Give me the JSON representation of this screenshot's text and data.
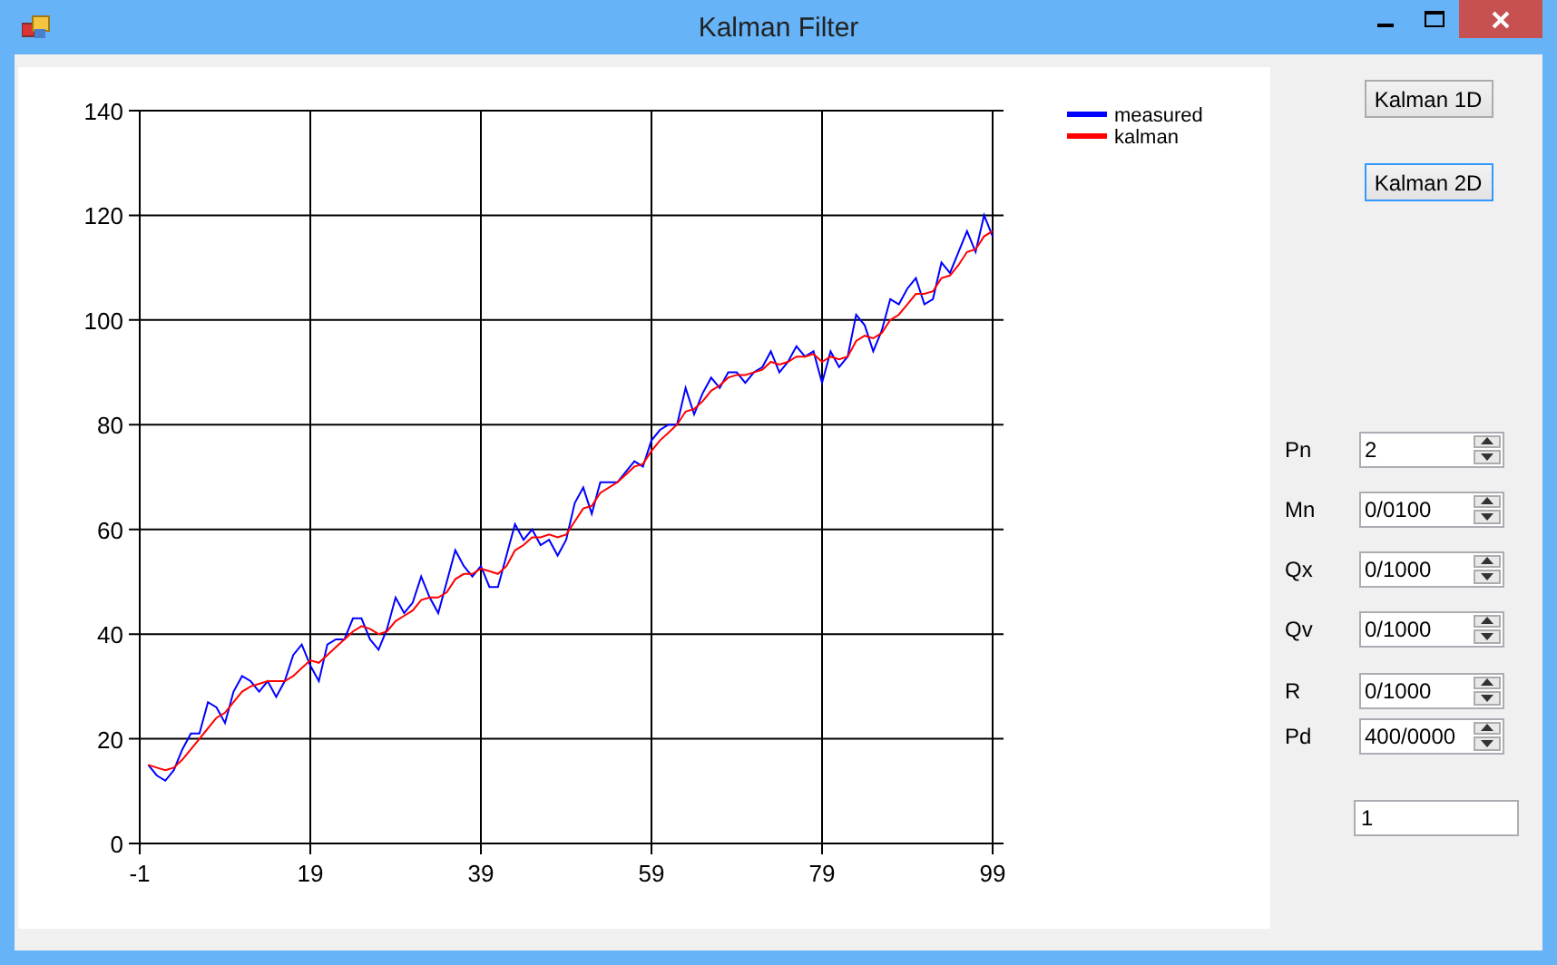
{
  "window": {
    "title": "Kalman Filter"
  },
  "chart": {
    "chart_data": {
      "type": "line",
      "grid": true,
      "legend": true,
      "xlim": [
        -1,
        99
      ],
      "ylim": [
        0,
        140
      ],
      "xticks": [
        -1,
        19,
        39,
        59,
        79,
        99
      ],
      "yticks": [
        0,
        20,
        40,
        60,
        80,
        100,
        120,
        140
      ],
      "x": [
        0,
        1,
        2,
        3,
        4,
        5,
        6,
        7,
        8,
        9,
        10,
        11,
        12,
        13,
        14,
        15,
        16,
        17,
        18,
        19,
        20,
        21,
        22,
        23,
        24,
        25,
        26,
        27,
        28,
        29,
        30,
        31,
        32,
        33,
        34,
        35,
        36,
        37,
        38,
        39,
        40,
        41,
        42,
        43,
        44,
        45,
        46,
        47,
        48,
        49,
        50,
        51,
        52,
        53,
        54,
        55,
        56,
        57,
        58,
        59,
        60,
        61,
        62,
        63,
        64,
        65,
        66,
        67,
        68,
        69,
        70,
        71,
        72,
        73,
        74,
        75,
        76,
        77,
        78,
        79,
        80,
        81,
        82,
        83,
        84,
        85,
        86,
        87,
        88,
        89,
        90,
        91,
        92,
        93,
        94,
        95,
        96,
        97,
        98,
        99
      ],
      "series": [
        {
          "name": "measured",
          "color": "#0000ff",
          "values": [
            15,
            13,
            12,
            14,
            18,
            21,
            21,
            27,
            26,
            23,
            29,
            32,
            31,
            29,
            31,
            28,
            31,
            36,
            38,
            34,
            31,
            38,
            39,
            39,
            43,
            43,
            39,
            37,
            41,
            47,
            44,
            46,
            51,
            47,
            44,
            50,
            56,
            53,
            51,
            53,
            49,
            49,
            55,
            61,
            58,
            60,
            57,
            58,
            55,
            58,
            65,
            68,
            63,
            69,
            69,
            69,
            71,
            73,
            72,
            77,
            79,
            80,
            80,
            87,
            82,
            86,
            89,
            87,
            90,
            90,
            88,
            90,
            91,
            94,
            90,
            92,
            95,
            93,
            94,
            88,
            94,
            91,
            93,
            101,
            99,
            94,
            98,
            104,
            103,
            106,
            108,
            103,
            104,
            111,
            109,
            113,
            117,
            113,
            120,
            116
          ]
        },
        {
          "name": "kalman",
          "color": "#ff0000",
          "values": [
            15,
            14.5,
            14,
            14.5,
            16,
            18,
            20,
            22,
            24,
            25,
            27,
            29,
            30,
            30.5,
            31,
            31,
            31,
            32,
            33.5,
            35,
            34.5,
            36,
            37.5,
            39,
            40.5,
            41.5,
            41,
            40,
            40.5,
            42.5,
            43.5,
            44.5,
            46.5,
            47,
            47,
            48,
            50.5,
            51.5,
            51.5,
            52.5,
            52,
            51.5,
            53,
            56,
            57,
            58.5,
            58.5,
            59,
            58.5,
            59,
            61.5,
            64,
            64.5,
            67,
            68,
            69,
            70.5,
            72,
            72.5,
            75,
            77,
            78.5,
            80,
            82.5,
            83,
            84.5,
            86.5,
            87.5,
            89,
            89.5,
            89.5,
            90,
            90.5,
            92,
            91.5,
            92,
            93,
            93,
            93.5,
            92,
            93,
            92.5,
            93,
            96,
            97,
            96.5,
            97.5,
            100,
            101,
            103,
            105,
            105,
            105.5,
            108,
            108.5,
            110.5,
            113,
            113.5,
            116,
            117
          ]
        }
      ]
    }
  },
  "buttons": [
    {
      "label": "Kalman 1D",
      "focused": false
    },
    {
      "label": "Kalman 2D",
      "focused": true
    }
  ],
  "parameters": [
    {
      "label": "Pn",
      "value": "2"
    },
    {
      "label": "Mn",
      "value": "0/0100"
    },
    {
      "label": "Qx",
      "value": "0/1000"
    },
    {
      "label": "Qv",
      "value": "0/1000"
    },
    {
      "label": "R",
      "value": "0/1000"
    },
    {
      "label": "Pd",
      "value": "400/0000"
    }
  ],
  "result_field": {
    "value": "1"
  }
}
